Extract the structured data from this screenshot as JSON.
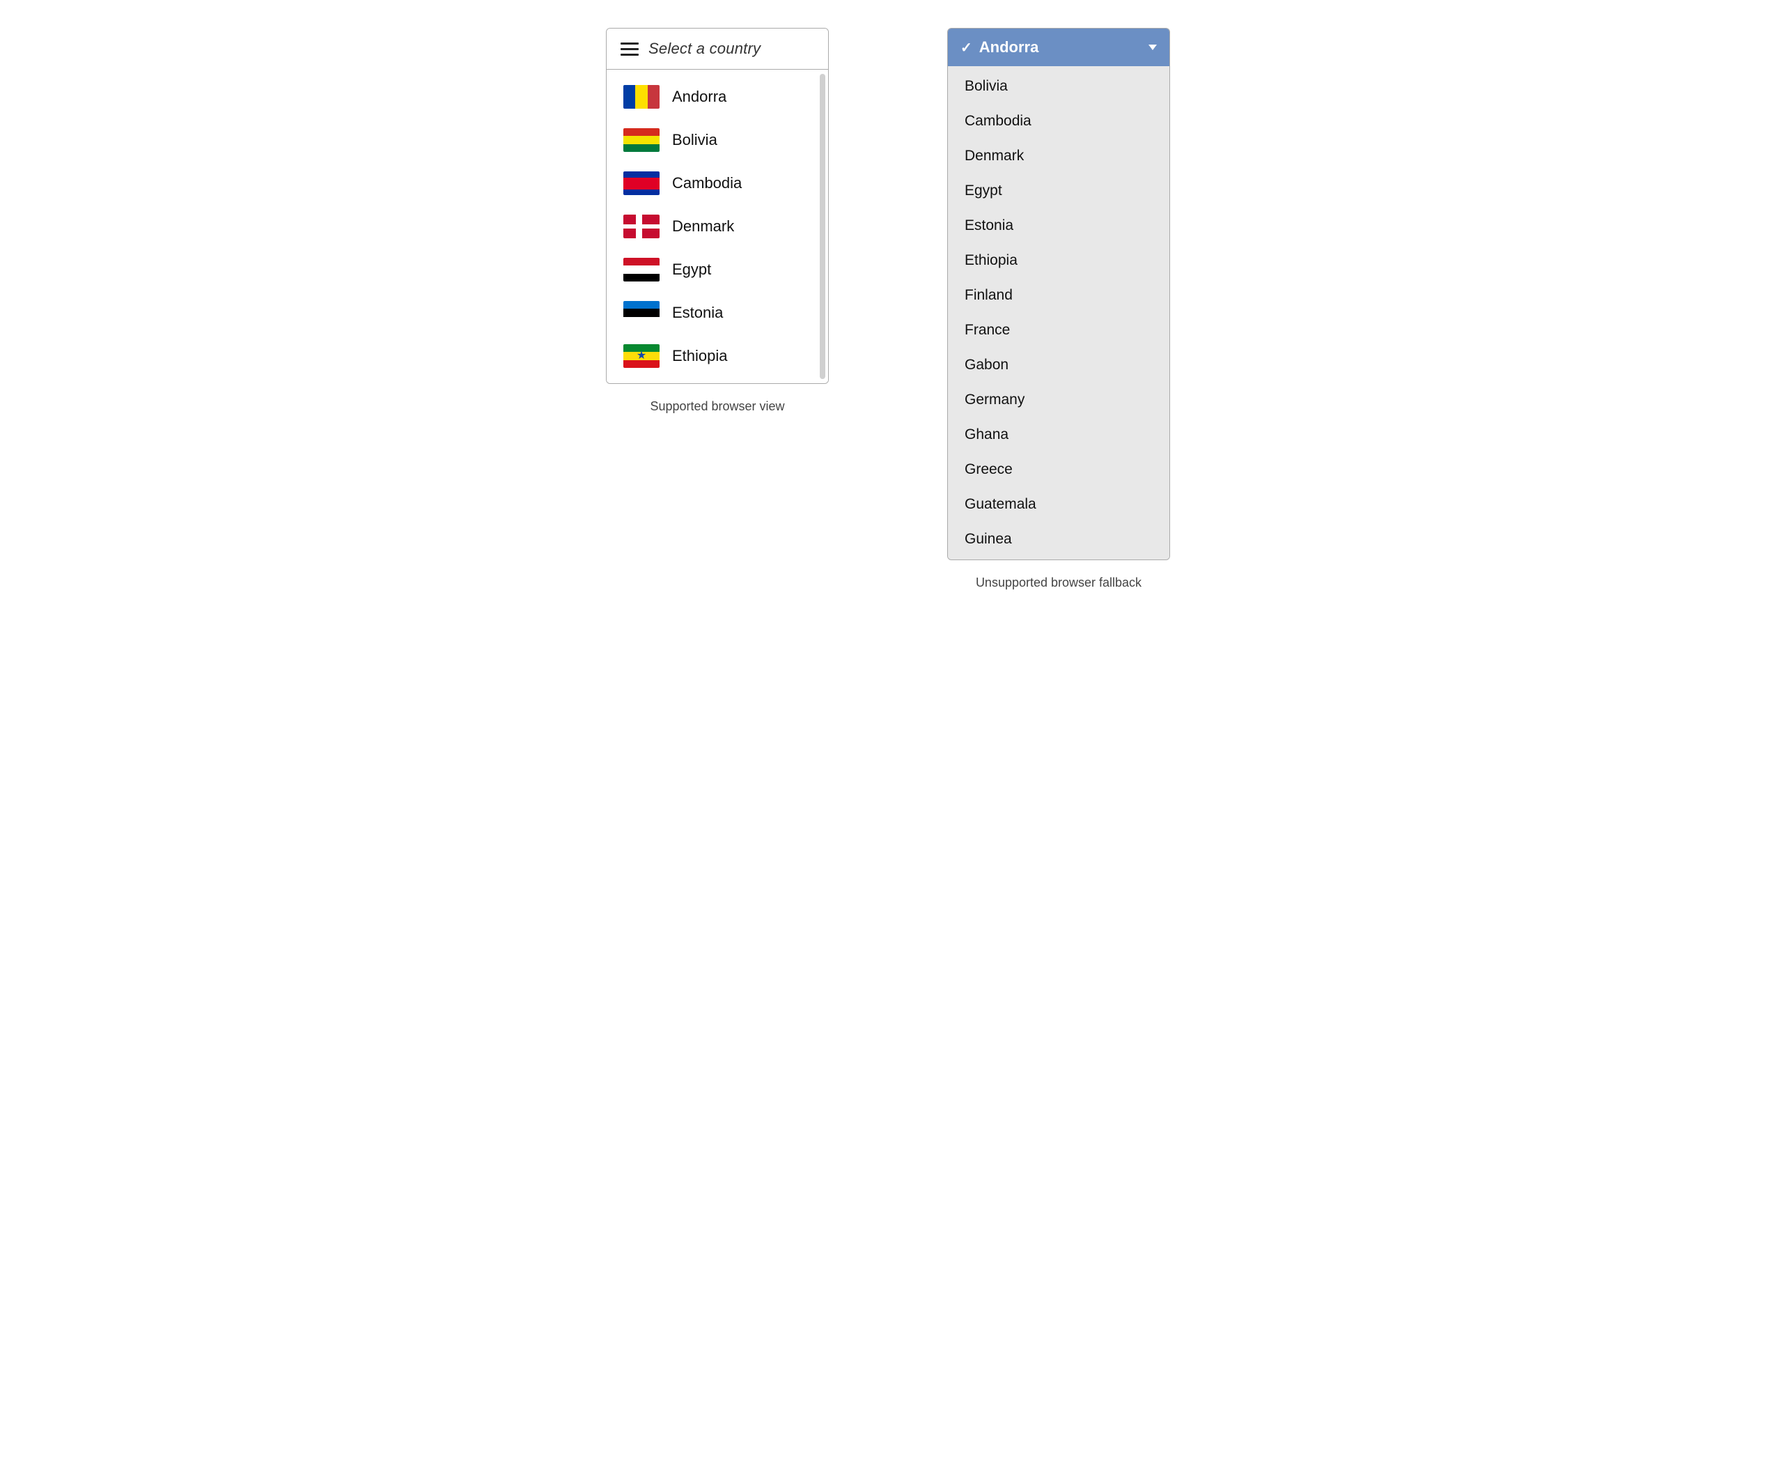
{
  "left": {
    "placeholder": "Select a country",
    "label": "Supported browser view",
    "countries": [
      {
        "name": "Andorra",
        "flag": "andorra"
      },
      {
        "name": "Bolivia",
        "flag": "bolivia"
      },
      {
        "name": "Cambodia",
        "flag": "cambodia"
      },
      {
        "name": "Denmark",
        "flag": "denmark"
      },
      {
        "name": "Egypt",
        "flag": "egypt"
      },
      {
        "name": "Estonia",
        "flag": "estonia"
      },
      {
        "name": "Ethiopia",
        "flag": "ethiopia"
      }
    ]
  },
  "right": {
    "label": "Unsupported browser fallback",
    "selected": "Andorra",
    "options": [
      "Bolivia",
      "Cambodia",
      "Denmark",
      "Egypt",
      "Estonia",
      "Ethiopia",
      "Finland",
      "France",
      "Gabon",
      "Germany",
      "Ghana",
      "Greece",
      "Guatemala",
      "Guinea"
    ]
  }
}
